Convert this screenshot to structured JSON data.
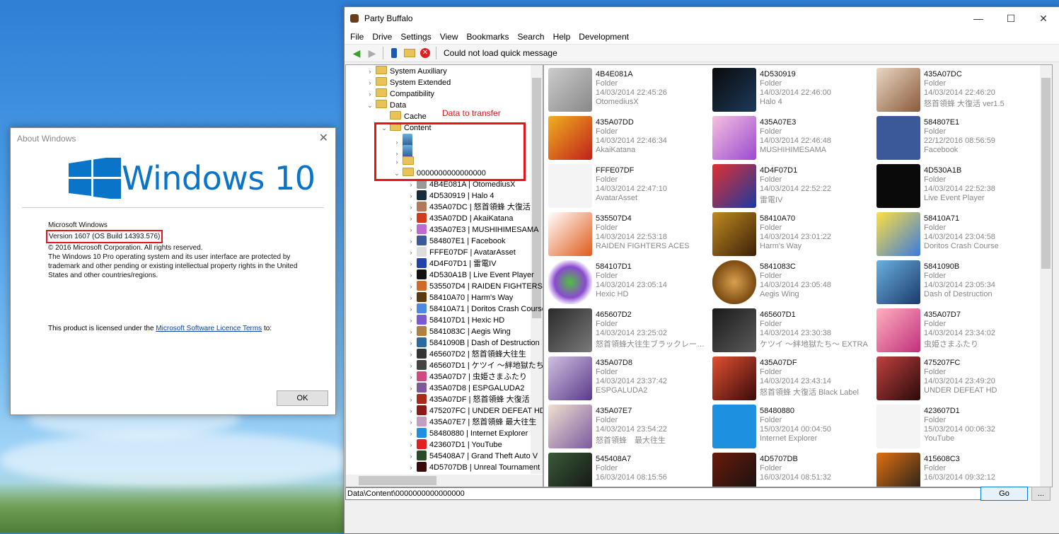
{
  "about": {
    "title": "About Windows",
    "logo_text": "Windows 10",
    "product": "Microsoft Windows",
    "version": "Version 1607 (OS Build 14393.576)",
    "copyright": "© 2016 Microsoft Corporation. All rights reserved.",
    "description": "The Windows 10 Pro operating system and its user interface are protected by trademark and other pending or existing intellectual property rights in the United States and other countries/regions.",
    "license_prefix": "This product is licensed under the",
    "license_link": "Microsoft Software Licence Terms",
    "license_suffix": "to:",
    "ok": "OK"
  },
  "app": {
    "title": "Party Buffalo",
    "menu": [
      "File",
      "Drive",
      "Settings",
      "View",
      "Bookmarks",
      "Search",
      "Help",
      "Development"
    ],
    "toolbar_message": "Could not load quick message",
    "annotation": "Data to transfer",
    "path": "Data\\Content\\0000000000000000",
    "go": "Go",
    "more": "...",
    "tree": [
      {
        "label": "System Auxiliary",
        "kind": "folder",
        "level": 2,
        "exp": "›"
      },
      {
        "label": "System Extended",
        "kind": "folder",
        "level": 2,
        "exp": "›"
      },
      {
        "label": "Compatibility",
        "kind": "folder",
        "level": 2,
        "exp": "›"
      },
      {
        "label": "Data",
        "kind": "folder",
        "level": 2,
        "exp": "⌄"
      },
      {
        "label": "Cache",
        "kind": "folder",
        "level": 3,
        "exp": ""
      },
      {
        "label": "Content",
        "kind": "folder",
        "level": 3,
        "exp": "⌄"
      },
      {
        "label": "",
        "kind": "avatar",
        "level": 4,
        "exp": "›"
      },
      {
        "label": "",
        "kind": "avatar",
        "level": 4,
        "exp": "›"
      },
      {
        "label": "",
        "kind": "folder",
        "level": 4,
        "exp": "›"
      },
      {
        "label": "0000000000000000",
        "kind": "folder",
        "level": 4,
        "exp": "⌄"
      },
      {
        "label": "4B4E081A | OtomediusX",
        "kind": "game",
        "level": 5,
        "exp": "›",
        "color": "#999"
      },
      {
        "label": "4D530919 | Halo 4",
        "kind": "game",
        "level": 5,
        "exp": "›",
        "color": "#1a2b3a"
      },
      {
        "label": "435A07DC | 怒首領蜂 大復活",
        "kind": "game",
        "level": 5,
        "exp": "›",
        "color": "#b07a5a"
      },
      {
        "label": "435A07DD | AkaiKatana",
        "kind": "game",
        "level": 5,
        "exp": "›",
        "color": "#d23a1e"
      },
      {
        "label": "435A07E3 | MUSHIHIMESAMA",
        "kind": "game",
        "level": 5,
        "exp": "›",
        "color": "#c06ad0"
      },
      {
        "label": "584807E1 | Facebook",
        "kind": "game",
        "level": 5,
        "exp": "›",
        "color": "#3b5998"
      },
      {
        "label": "FFFE07DF | AvatarAsset",
        "kind": "game",
        "level": 5,
        "exp": "›",
        "color": "#ddd"
      },
      {
        "label": "4D4F07D1 | 雷電IV",
        "kind": "game",
        "level": 5,
        "exp": "›",
        "color": "#2244aa"
      },
      {
        "label": "4D530A1B | Live Event Player",
        "kind": "game",
        "level": 5,
        "exp": "›",
        "color": "#111"
      },
      {
        "label": "535507D4 | RAIDEN FIGHTERS ACES",
        "kind": "game",
        "level": 5,
        "exp": "›",
        "color": "#d06a2a"
      },
      {
        "label": "58410A70 | Harm's Way",
        "kind": "game",
        "level": 5,
        "exp": "›",
        "color": "#5a3a10"
      },
      {
        "label": "58410A71 | Doritos Crash Course",
        "kind": "game",
        "level": 5,
        "exp": "›",
        "color": "#4a8ae0"
      },
      {
        "label": "584107D1 | Hexic HD",
        "kind": "game",
        "level": 5,
        "exp": "›",
        "color": "#7a5ad0"
      },
      {
        "label": "5841083C | Aegis Wing",
        "kind": "game",
        "level": 5,
        "exp": "›",
        "color": "#b08040"
      },
      {
        "label": "5841090B | Dash of Destruction",
        "kind": "game",
        "level": 5,
        "exp": "›",
        "color": "#2a6aa0"
      },
      {
        "label": "465607D2 | 怒首領蜂大往生",
        "kind": "game",
        "level": 5,
        "exp": "›",
        "color": "#333"
      },
      {
        "label": "465607D1 | ケツイ ～絆地獄たち～",
        "kind": "game",
        "level": 5,
        "exp": "›",
        "color": "#444"
      },
      {
        "label": "435A07D7 | 虫姫さまふたり",
        "kind": "game",
        "level": 5,
        "exp": "›",
        "color": "#d04a80"
      },
      {
        "label": "435A07D8 | ESPGALUDA2",
        "kind": "game",
        "level": 5,
        "exp": "›",
        "color": "#7a5a9a"
      },
      {
        "label": "435A07DF | 怒首領蜂 大復活",
        "kind": "game",
        "level": 5,
        "exp": "›",
        "color": "#aa2a1a"
      },
      {
        "label": "475207FC | UNDER DEFEAT HD",
        "kind": "game",
        "level": 5,
        "exp": "›",
        "color": "#8a1a1a"
      },
      {
        "label": "435A07E7 | 怒首領蜂 最大往生",
        "kind": "game",
        "level": 5,
        "exp": "›",
        "color": "#c0a0c0"
      },
      {
        "label": "58480880 | Internet Explorer",
        "kind": "game",
        "level": 5,
        "exp": "›",
        "color": "#1e90e0"
      },
      {
        "label": "423607D1 | YouTube",
        "kind": "game",
        "level": 5,
        "exp": "›",
        "color": "#e02020"
      },
      {
        "label": "545408A7 | Grand Theft Auto V",
        "kind": "game",
        "level": 5,
        "exp": "›",
        "color": "#2a4a2a"
      },
      {
        "label": "4D5707DB | Unreal Tournament",
        "kind": "game",
        "level": 5,
        "exp": "›",
        "color": "#3a0a0a"
      }
    ],
    "tiles": [
      {
        "id": "4B4E081A",
        "type": "Folder",
        "date": "14/03/2014 22:45:26",
        "name": "OtomediusX",
        "bg": "linear-gradient(135deg,#ccc,#888)"
      },
      {
        "id": "4D530919",
        "type": "Folder",
        "date": "14/03/2014 22:46:00",
        "name": "Halo 4",
        "bg": "linear-gradient(135deg,#0a0a0a,#1c3a5a)"
      },
      {
        "id": "435A07DC",
        "type": "Folder",
        "date": "14/03/2014 22:46:20",
        "name": "怒首領蜂 大復活 ver1.5",
        "bg": "linear-gradient(135deg,#e9d7c5,#8a5a3a)"
      },
      {
        "id": "435A07DD",
        "type": "Folder",
        "date": "14/03/2014 22:46:34",
        "name": "AkaiKatana",
        "bg": "linear-gradient(135deg,#f0b020,#c0201a)"
      },
      {
        "id": "435A07E3",
        "type": "Folder",
        "date": "14/03/2014 22:46:48",
        "name": "MUSHIHIMESAMA",
        "bg": "linear-gradient(135deg,#f5c0e0,#9a4ad0)"
      },
      {
        "id": "584807E1",
        "type": "Folder",
        "date": "22/12/2016 08:56:59",
        "name": "Facebook",
        "bg": "#3b5998"
      },
      {
        "id": "FFFE07DF",
        "type": "Folder",
        "date": "14/03/2014 22:47:10",
        "name": "AvatarAsset",
        "bg": "#f4f4f4"
      },
      {
        "id": "4D4F07D1",
        "type": "Folder",
        "date": "14/03/2014 22:52:22",
        "name": "雷電IV",
        "bg": "linear-gradient(135deg,#e03030,#1a3aa0)"
      },
      {
        "id": "4D530A1B",
        "type": "Folder",
        "date": "14/03/2014 22:52:38",
        "name": "Live Event Player",
        "bg": "#0a0a0a"
      },
      {
        "id": "535507D4",
        "type": "Folder",
        "date": "14/03/2014 22:53:18",
        "name": "RAIDEN FIGHTERS ACES",
        "bg": "linear-gradient(135deg,#fff,#e05a1a)"
      },
      {
        "id": "58410A70",
        "type": "Folder",
        "date": "14/03/2014 23:01:22",
        "name": "Harm's Way",
        "bg": "linear-gradient(135deg,#c08a20,#3a2008)"
      },
      {
        "id": "58410A71",
        "type": "Folder",
        "date": "14/03/2014 23:04:58",
        "name": "Doritos Crash Course",
        "bg": "linear-gradient(135deg,#ffe040,#3a7ae0)"
      },
      {
        "id": "584107D1",
        "type": "Folder",
        "date": "14/03/2014 23:05:14",
        "name": "Hexic HD",
        "bg": "radial-gradient(circle,#50c040,#8a4ad0 50%,#fff 75%)"
      },
      {
        "id": "5841083C",
        "type": "Folder",
        "date": "14/03/2014 23:05:48",
        "name": "Aegis Wing",
        "bg": "radial-gradient(circle,#d8a050,#7a4a10 70%,#fff 72%)"
      },
      {
        "id": "5841090B",
        "type": "Folder",
        "date": "14/03/2014 23:05:34",
        "name": "Dash of Destruction",
        "bg": "linear-gradient(135deg,#6ab0e0,#1a3a6a)"
      },
      {
        "id": "465607D2",
        "type": "Folder",
        "date": "14/03/2014 23:25:02",
        "name": "怒首領蜂大往生ブラックレーベル EXTRA",
        "bg": "linear-gradient(135deg,#2a2a2a,#7a7a7a)"
      },
      {
        "id": "465607D1",
        "type": "Folder",
        "date": "14/03/2014 23:30:38",
        "name": "ケツイ ～絆地獄たち～ EXTRA",
        "bg": "linear-gradient(135deg,#1a1a1a,#5a5a5a)"
      },
      {
        "id": "435A07D7",
        "type": "Folder",
        "date": "14/03/2014 23:34:02",
        "name": "虫姫さまふたり",
        "bg": "linear-gradient(135deg,#ffb0c0,#c0307a)"
      },
      {
        "id": "435A07D8",
        "type": "Folder",
        "date": "14/03/2014 23:37:42",
        "name": "ESPGALUDA2",
        "bg": "linear-gradient(135deg,#d0c0e0,#5a3a8a)"
      },
      {
        "id": "435A07DF",
        "type": "Folder",
        "date": "14/03/2014 23:43:14",
        "name": "怒首領蜂 大復活 Black Label",
        "bg": "linear-gradient(135deg,#e05030,#3a0a0a)"
      },
      {
        "id": "475207FC",
        "type": "Folder",
        "date": "14/03/2014 23:49:20",
        "name": "UNDER DEFEAT HD",
        "bg": "linear-gradient(135deg,#c04040,#2a0a0a)"
      },
      {
        "id": "435A07E7",
        "type": "Folder",
        "date": "14/03/2014 23:54:22",
        "name": "怒首領蜂　最大往生",
        "bg": "linear-gradient(135deg,#f0e0d0,#7a5aa0)"
      },
      {
        "id": "58480880",
        "type": "Folder",
        "date": "15/03/2014 00:04:50",
        "name": "Internet Explorer",
        "bg": "#1e90e0"
      },
      {
        "id": "423607D1",
        "type": "Folder",
        "date": "15/03/2014 00:06:32",
        "name": "YouTube",
        "bg": "#f4f4f4"
      },
      {
        "id": "545408A7",
        "type": "Folder",
        "date": "16/03/2014 08:15:56",
        "name": "",
        "bg": "linear-gradient(135deg,#3a5a3a,#111)"
      },
      {
        "id": "4D5707DB",
        "type": "Folder",
        "date": "16/03/2014 08:51:32",
        "name": "",
        "bg": "linear-gradient(135deg,#6a1a0a,#111)"
      },
      {
        "id": "415608C3",
        "type": "Folder",
        "date": "16/03/2014 09:32:12",
        "name": "",
        "bg": "linear-gradient(135deg,#e07010,#1a1a1a)"
      }
    ]
  }
}
